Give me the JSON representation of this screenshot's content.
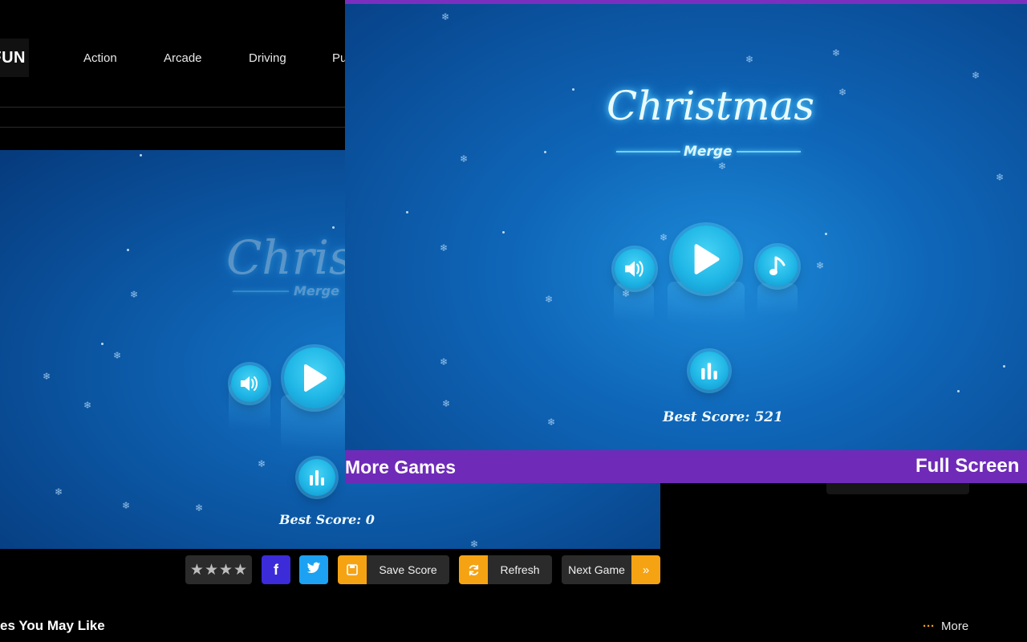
{
  "header": {
    "logo_text": "FUN",
    "nav": [
      "Action",
      "Arcade",
      "Driving",
      "Pu"
    ]
  },
  "background_game": {
    "title": "Christm",
    "subtitle": "Merge",
    "best_score": "Best Score: 0"
  },
  "foreground_game": {
    "title": "Christmas",
    "subtitle": "Merge",
    "best_score": "Best Score: 521",
    "more_games": "More Games",
    "full_screen": "Full Screen"
  },
  "action_bar": {
    "save_score": "Save Score",
    "refresh": "Refresh",
    "next_game": "Next Game",
    "facebook": "f",
    "twitter": "twitter",
    "rating_stars": 4
  },
  "related": {
    "title": "es You May Like",
    "more": "More"
  },
  "colors": {
    "accent_orange": "#f6a313",
    "facebook_blue": "#3b2bd8",
    "twitter_blue": "#1da1f2",
    "purple_bar": "#6f2bb8",
    "button_cyan": "#1fb6e6"
  },
  "icons": [
    "sound-icon",
    "play-icon",
    "music-icon",
    "leaderboard-icon",
    "save-icon",
    "refresh-icon",
    "double-chevron-right-icon",
    "star-icon"
  ]
}
